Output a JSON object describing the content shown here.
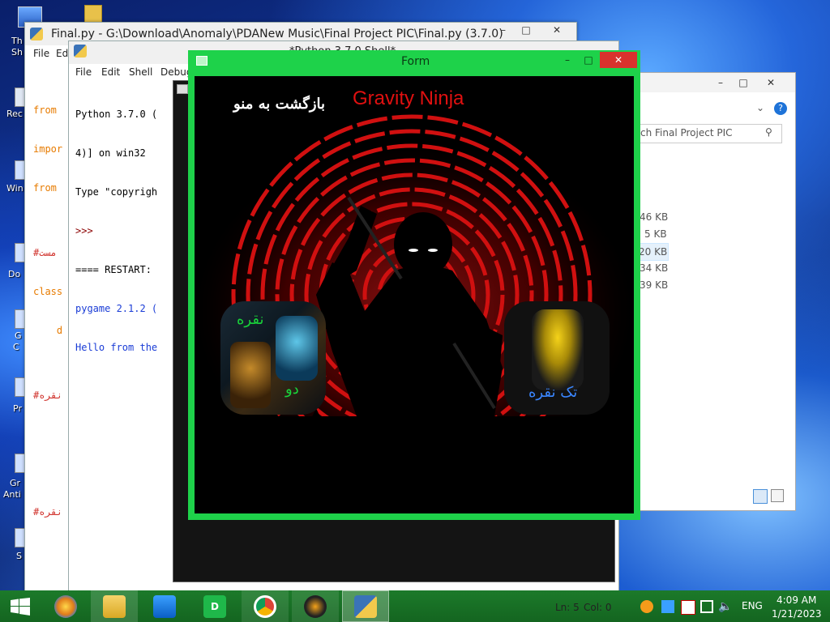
{
  "desktop": {
    "labels": [
      "Th",
      "Sh",
      "Rec",
      "Win",
      "Do",
      "G",
      "C",
      "Pr",
      "Gr",
      "Anti",
      "S"
    ]
  },
  "idle_editor": {
    "title": "Final.py - G:\\Download\\Anomaly\\PDANew Music\\Final Project PIC\\Final.py (3.7.0)",
    "menu": [
      "File",
      "Ed"
    ],
    "code_lines": [
      "from ",
      "impor",
      "from ",
      "",
      "#مست",
      "class",
      "    d"
    ],
    "comment1": "#نقره",
    "comment2": "#نقره"
  },
  "shell": {
    "title": "*Python 3.7.0 Shell*",
    "menu": [
      "File",
      "Edit",
      "Shell",
      "Debug"
    ],
    "lines": [
      "Python 3.7.0 (",
      "4)] on win32",
      "Type \"copyrigh",
      ">>>",
      "==== RESTART: ",
      "pygame 2.1.2 (",
      "Hello from the"
    ],
    "status": {
      "ln": "Ln: 5",
      "col": "Col: 0"
    }
  },
  "explorer": {
    "search_placeholder": "ch Final Project PIC",
    "sizes": [
      "46 KB",
      "5 KB",
      "20 KB",
      "34 KB",
      "39 KB"
    ]
  },
  "form": {
    "title": "Form",
    "back_label": "بازگشت به منو",
    "game_title": "Gravity Ninja",
    "two_label_top": "نقره",
    "two_label_bottom": "دو",
    "single_label": "تک نقره",
    "colors": {
      "border": "#1ed24a",
      "title_red": "#e01010"
    }
  },
  "taskbar": {
    "language": "ENG",
    "time": "4:09 AM",
    "date": "1/21/2023",
    "apps": [
      "start",
      "paint",
      "explorer",
      "remote",
      "downloader",
      "chrome",
      "gom",
      "python"
    ]
  }
}
